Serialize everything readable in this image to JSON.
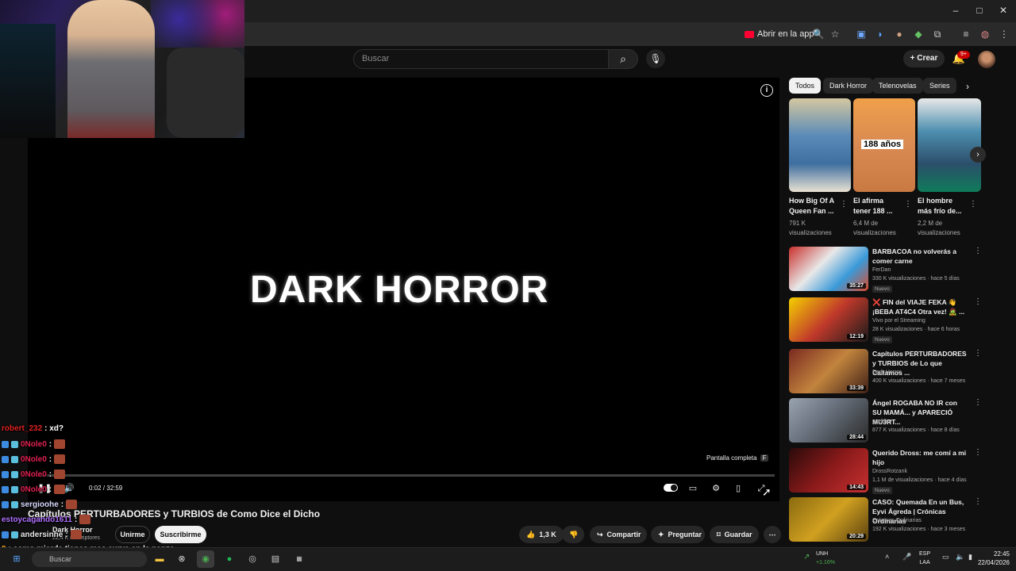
{
  "browser": {
    "open_in_app": "Abrir en la app",
    "window_controls": [
      "–",
      "□",
      "✕"
    ]
  },
  "header": {
    "search_placeholder": "Buscar",
    "create_label": "Crear",
    "notifications_badge": "9+"
  },
  "player": {
    "overlay_title": "DARK HORROR",
    "fullscreen_tip": "Pantalla completa",
    "fullscreen_key": "F",
    "time": "0:02 / 32:59",
    "progress_fraction": 0.001
  },
  "video": {
    "title": "Capítulos PERTURBADORES y TURBIOS de Como Dice el Dicho",
    "channel": "Dark Horror",
    "subscribers": "22,4 K suscriptores",
    "join_label": "Unirme",
    "subscribe_label": "Suscribirme",
    "likes": "1,3 K",
    "share_label": "Compartir",
    "ask_label": "Preguntar",
    "save_label": "Guardar"
  },
  "chat": [
    {
      "user": "robert_232",
      "color": "#e02020",
      "msg": ": xd?",
      "badges": false
    },
    {
      "user": "0Nole0",
      "color": "#e02050",
      "msg": ":",
      "badges": true
    },
    {
      "user": "0Nole0",
      "color": "#e02050",
      "msg": ":",
      "badges": true
    },
    {
      "user": "0Nole0",
      "color": "#e02050",
      "msg": ":",
      "badges": true
    },
    {
      "user": "0Nole0",
      "color": "#e02050",
      "msg": ":",
      "badges": true
    },
    {
      "user": "sergioohe",
      "color": "#d8d8ff",
      "msg": ":",
      "badges": true
    },
    {
      "user": "estoycagando1611",
      "color": "#b070ff",
      "msg": ":",
      "badges": false
    },
    {
      "user": "andersinhe",
      "color": "#e8e8e8",
      "msg": ":",
      "badges": true
    },
    {
      "user": "9",
      "color": "#ffb020",
      "msg": ": como mierda tienes mas curva en la panza",
      "badges": false
    },
    {
      "user": "sque poto",
      "color": "#ffffff",
      "msg": "",
      "badges": false
    }
  ],
  "chips": [
    "Todos",
    "Dark Horror",
    "Telenovelas",
    "Series d"
  ],
  "shorts": [
    {
      "title": "How Big Of A Queen Fan ...",
      "views": "791 K visualizaciones"
    },
    {
      "title": "El afirma tener 188 ...",
      "views": "6,4 M de visualizaciones",
      "overlay": "188 años"
    },
    {
      "title": "El hombre más frío de...",
      "views": "2,2 M de visualizaciones"
    }
  ],
  "recommended": [
    {
      "title": "BARBACOA no volverás a comer carne",
      "channel": "FerDan",
      "meta": "330 K visualizaciones · hace 5 días",
      "duration": "35:27",
      "badge": "Nuevo"
    },
    {
      "title": "❌ FIN del VIAJE FEKA 👋 ¡BEBA AT4C4 Otra vez! 🧟 ...",
      "channel": "Vivo por el Streaming",
      "meta": "28 K visualizaciones · hace 6 horas",
      "duration": "12:19",
      "badge": "Nuevo"
    },
    {
      "title": "Capítulos PERTURBADORES y TURBIOS de Lo que Callamos ...",
      "channel": "Dark Horror",
      "meta": "400 K visualizaciones · hace 7 meses",
      "duration": "33:39",
      "badge": ""
    },
    {
      "title": "Ángel ROGABA NO IR con SU MAMÁ... y APARECIÓ MU3RT...",
      "channel": "axeldee",
      "meta": "877 K visualizaciones · hace 8 días",
      "duration": "28:44",
      "badge": ""
    },
    {
      "title": "Querido Dross: me comí a mi hijo",
      "channel": "DrossRotzank",
      "meta": "1,1 M de visualizaciones · hace 4 días",
      "duration": "14:43",
      "badge": "Nuevo"
    },
    {
      "title": "CASO: Quemada En un Bus, Eyvi Ágreda | Crónicas Ordinarias",
      "channel": "Crónicas Ordinarias",
      "meta": "192 K visualizaciones · hace 3 meses",
      "duration": "20:29",
      "badge": ""
    }
  ],
  "taskbar": {
    "search_placeholder": "Buscar",
    "ticker_name": "UNH",
    "ticker_change": "+1.16%",
    "lang_top": "ESP",
    "lang_bottom": "LAA",
    "time": "22:45",
    "date": "22/04/2026"
  }
}
